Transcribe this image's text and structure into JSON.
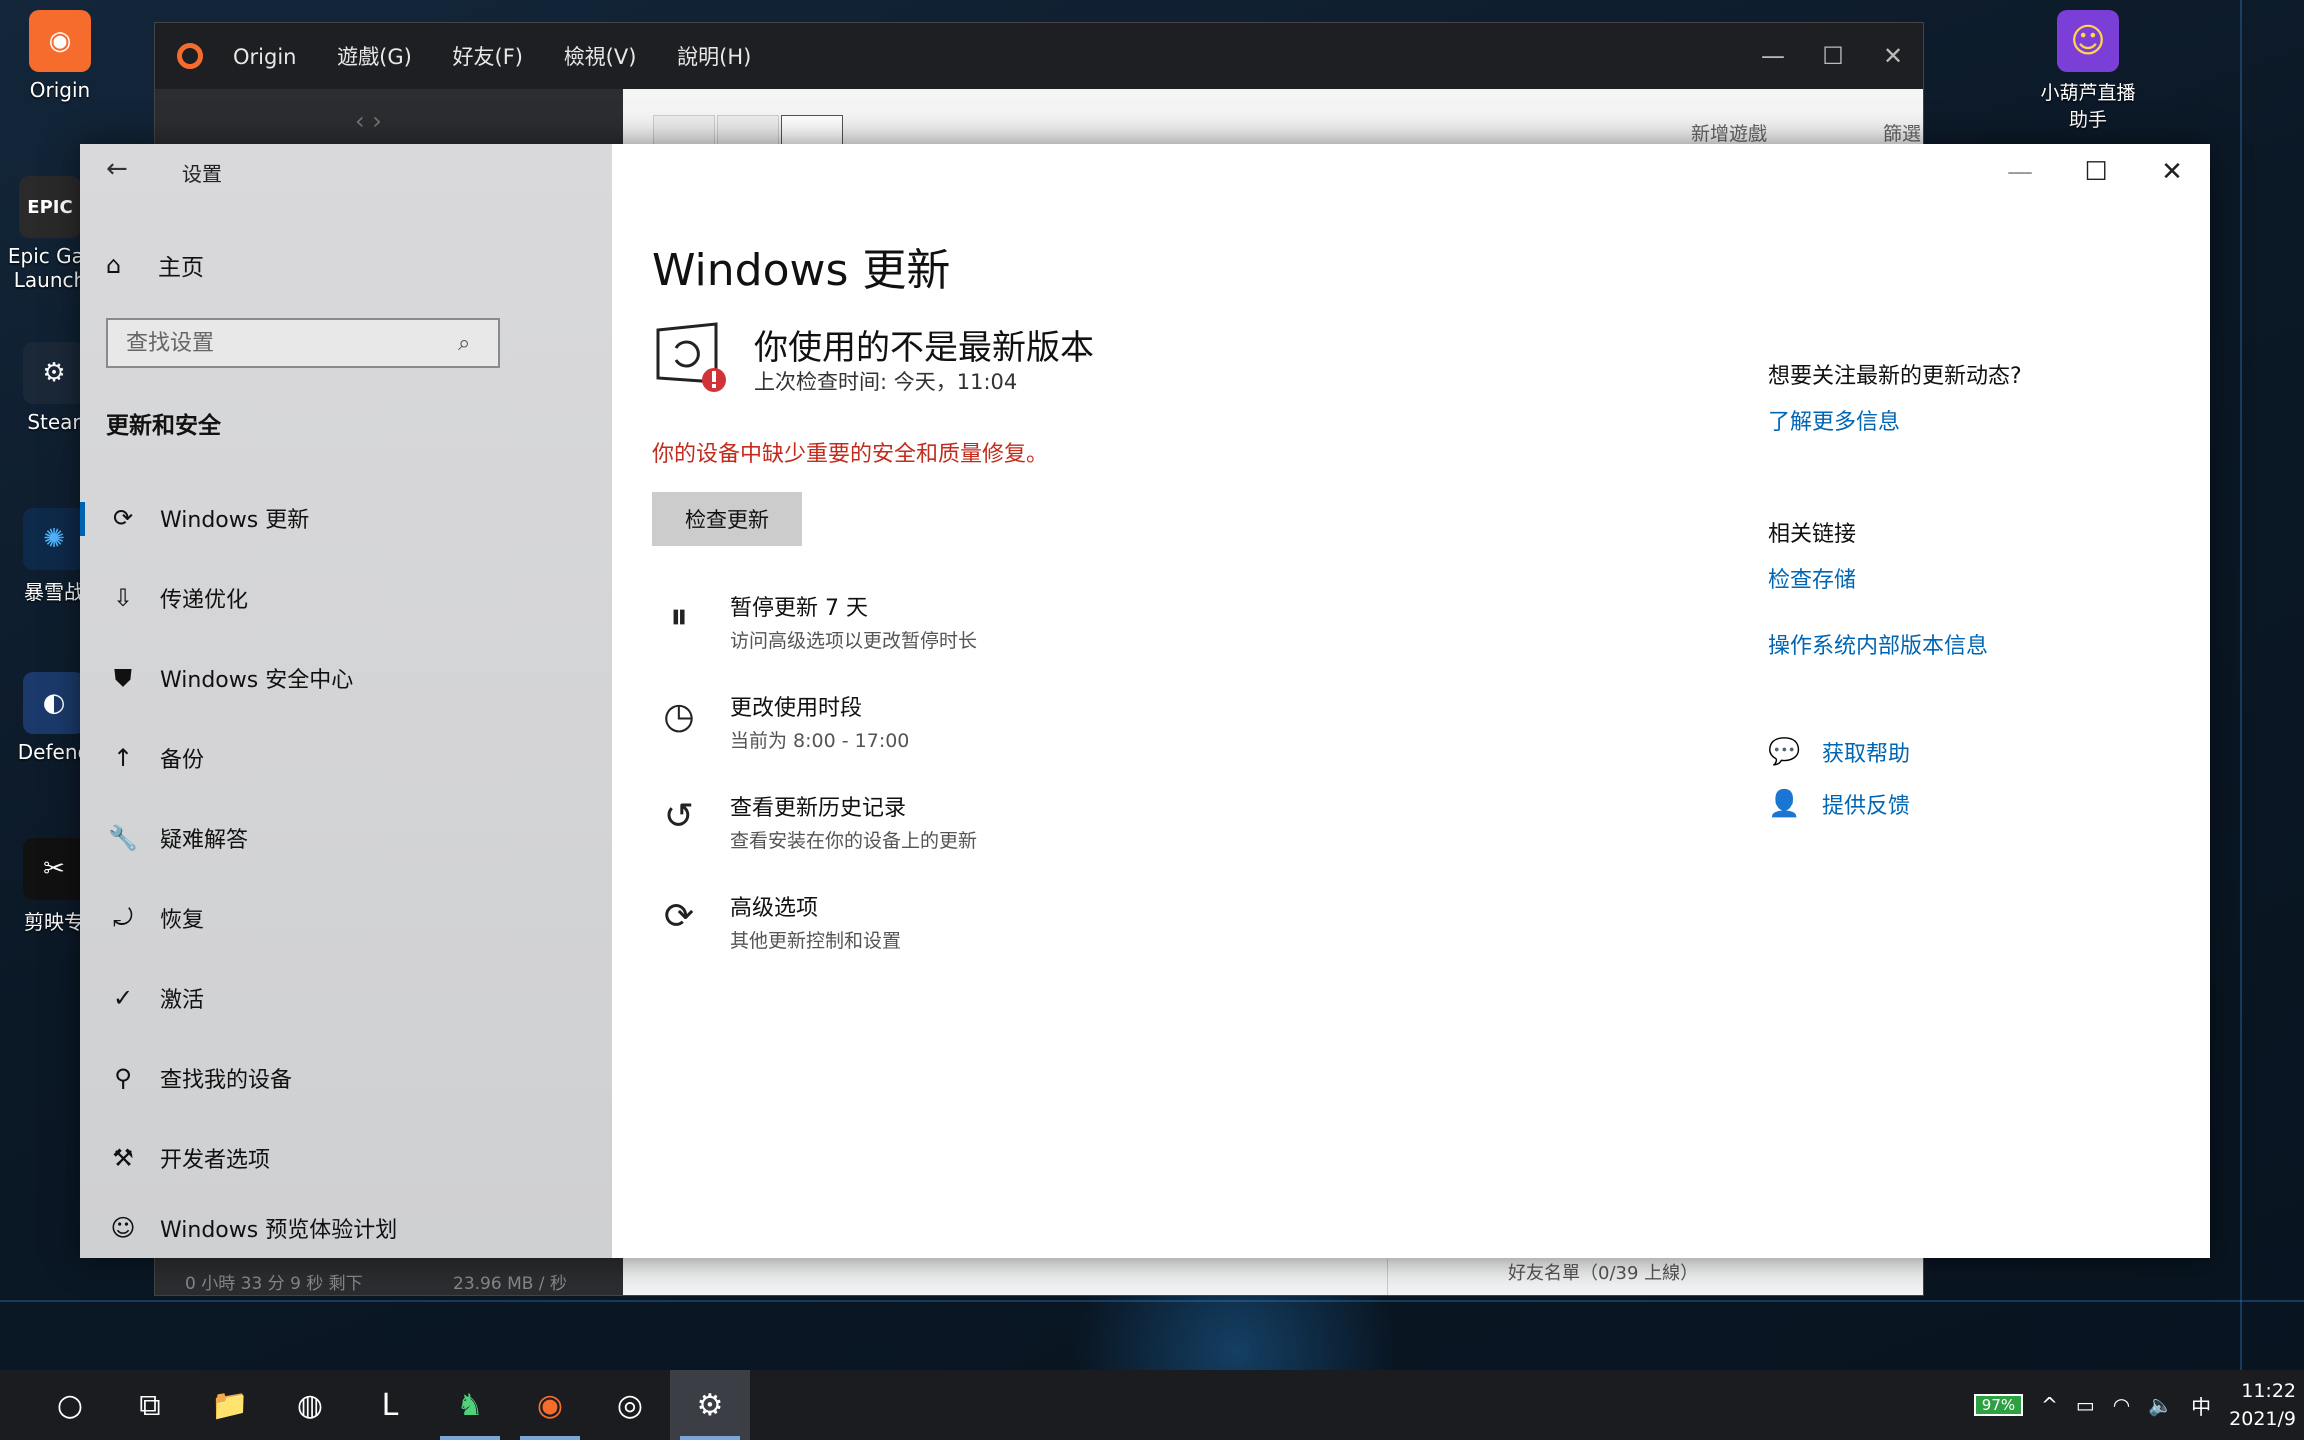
{
  "desktop": {
    "icons": [
      {
        "name": "Origin",
        "glyph": "◉",
        "color": "#f56c2d"
      },
      {
        "name": "Epic Gar Launch",
        "glyph": "EPIC",
        "color": "#2a2a2a"
      },
      {
        "name": "Stear",
        "glyph": "⚙",
        "color": "#1b2838"
      },
      {
        "name": "暴雪战",
        "glyph": "✺",
        "color": "#0e2a4a"
      },
      {
        "name": "Defend",
        "glyph": "◐",
        "color": "#1b3a6b"
      },
      {
        "name": "剪映专",
        "glyph": "✂",
        "color": "#111"
      }
    ],
    "right_icon": {
      "name": "小葫芦直播助手",
      "glyph": "☺",
      "color": "#7b3fd8"
    }
  },
  "origin": {
    "title": "Origin",
    "menu": [
      "遊戲(G)",
      "好友(F)",
      "檢視(V)",
      "說明(H)"
    ],
    "add_game": "新增遊戲",
    "filter": "篩選條件",
    "bottom_left": "0 小時 33 分 9 秒 剩下",
    "bottom_speed": "23.96 MB / 秒",
    "bottom_right": "好友名單（0/39 上線）"
  },
  "settings": {
    "window_title": "设置",
    "home": "主页",
    "search_placeholder": "查找设置",
    "section": "更新和安全",
    "nav": [
      {
        "label": "Windows 更新",
        "icon": "⟳",
        "active": true
      },
      {
        "label": "传递优化",
        "icon": "⇩"
      },
      {
        "label": "Windows 安全中心",
        "icon": "⛊"
      },
      {
        "label": "备份",
        "icon": "↑"
      },
      {
        "label": "疑难解答",
        "icon": "🔧"
      },
      {
        "label": "恢复",
        "icon": "⤾"
      },
      {
        "label": "激活",
        "icon": "✓"
      },
      {
        "label": "查找我的设备",
        "icon": "⚲"
      },
      {
        "label": "开发者选项",
        "icon": "⚒"
      },
      {
        "label": "Windows 预览体验计划",
        "icon": "☺"
      }
    ],
    "main": {
      "title": "Windows 更新",
      "status_title": "你使用的不是最新版本",
      "status_sub": "上次检查时间: 今天，11:04",
      "warning": "你的设备中缺少重要的安全和质量修复。",
      "check_button": "检查更新",
      "options": [
        {
          "title": "暂停更新 7 天",
          "sub": "访问高级选项以更改暂停时长",
          "icon": "⏸"
        },
        {
          "title": "更改使用时段",
          "sub": "当前为 8:00 - 17:00",
          "icon": "◷"
        },
        {
          "title": "查看更新历史记录",
          "sub": "查看安装在你的设备上的更新",
          "icon": "↺"
        },
        {
          "title": "高级选项",
          "sub": "其他更新控制和设置",
          "icon": "⟳"
        }
      ]
    },
    "right": {
      "q1": "想要关注最新的更新动态?",
      "learn_more": "了解更多信息",
      "related": "相关链接",
      "check_storage": "检查存储",
      "os_build": "操作系统内部版本信息",
      "get_help": "获取帮助",
      "feedback": "提供反馈"
    }
  },
  "taskbar": {
    "apps": [
      {
        "glyph": "○",
        "name": "cortana"
      },
      {
        "glyph": "⧉",
        "name": "task-view"
      },
      {
        "glyph": "📁",
        "name": "file-explorer"
      },
      {
        "glyph": "◍",
        "name": "chrome"
      },
      {
        "glyph": "L",
        "name": "app-l"
      },
      {
        "glyph": "♞",
        "name": "app-green"
      },
      {
        "glyph": "◉",
        "name": "origin"
      },
      {
        "glyph": "◎",
        "name": "obs"
      },
      {
        "glyph": "⚙",
        "name": "settings"
      }
    ],
    "battery": "97%",
    "ime": "中",
    "time": "11:22",
    "date": "2021/9"
  }
}
